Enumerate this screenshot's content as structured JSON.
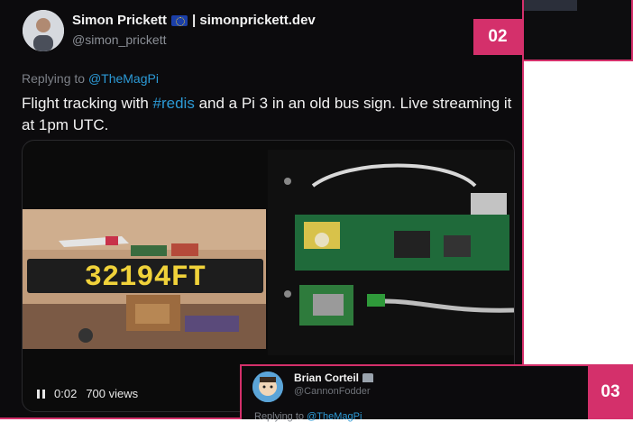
{
  "tweet": {
    "author_name": "Simon Prickett",
    "author_suffix": "| simonprickett.dev",
    "handle": "@simon_prickett",
    "replying_prefix": "Replying to",
    "replying_to": "@TheMagPi",
    "text_before": "Flight tracking with",
    "hashtag": "#redis",
    "text_after": "and a Pi 3 in an old bus sign. Live streaming it at 1pm UTC.",
    "badge": "02",
    "video": {
      "time": "0:02",
      "views": "700 views",
      "display_text": "32194FT"
    }
  },
  "reply_card": {
    "author_name": "Brian Corteil",
    "handle": "@CannonFodder",
    "replying_prefix": "Replying to",
    "replying_to": "@TheMagPi",
    "badge": "03"
  },
  "colors": {
    "accent": "#d4306b",
    "link": "#2c9ad6",
    "card_bg": "#0c0b0d",
    "led": "#f0d23a"
  }
}
